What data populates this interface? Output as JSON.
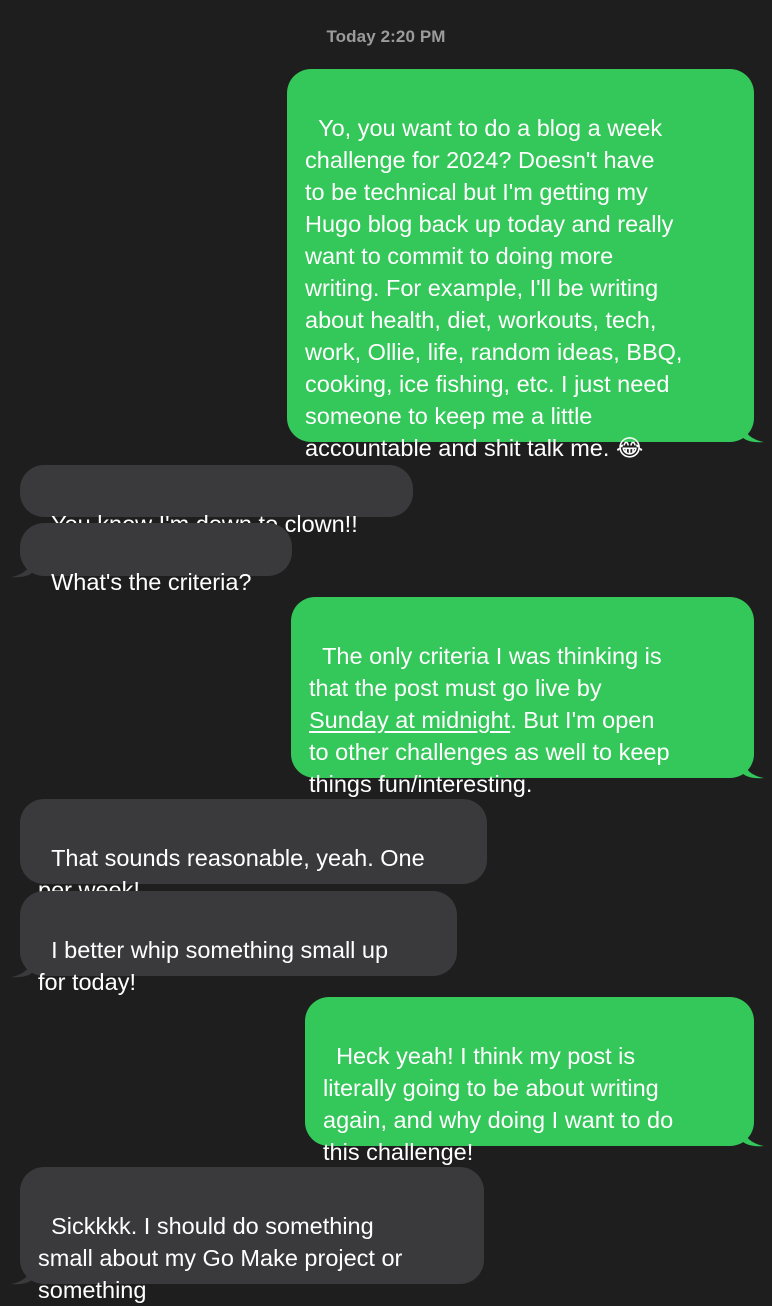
{
  "header": {
    "timestamp": "Today 2:20 PM"
  },
  "messages": [
    {
      "direction": "sent",
      "text": "Yo, you want to do a blog a week\nchallenge for 2024? Doesn't have\nto be technical but I'm getting my\nHugo blog back up today and really\nwant to commit to doing more\nwriting. For example, I'll be writing\nabout health, diet, workouts, tech,\nwork, Ollie, life, random ideas, BBQ,\ncooking, ice fishing, etc. I just need\nsomeone to keep me a little\naccountable and shit talk me. 😂"
    },
    {
      "direction": "received",
      "text": "You know I'm down to clown!!"
    },
    {
      "direction": "received",
      "text": "What's the criteria?"
    },
    {
      "direction": "sent",
      "text_before": "The only criteria I was thinking is\nthat the post must go live by\n",
      "link_text": "Sunday at midnight",
      "text_after": ". But I'm open\nto other challenges as well to keep\nthings fun/interesting."
    },
    {
      "direction": "received",
      "text": "That sounds reasonable, yeah. One\nper week!"
    },
    {
      "direction": "received",
      "text": "I better whip something small up\nfor today!"
    },
    {
      "direction": "sent",
      "text": "Heck yeah! I think my post is\nliterally going to be about writing\nagain, and why doing I want to do\nthis challenge!"
    },
    {
      "direction": "received",
      "text": "Sickkkk. I should do something\nsmall about my Go Make project or\nsomething"
    }
  ],
  "colors": {
    "background": "#1e1e1e",
    "sent_bubble": "#34c759",
    "received_bubble": "#3a3a3c",
    "timestamp_text": "#9b9b9b"
  }
}
